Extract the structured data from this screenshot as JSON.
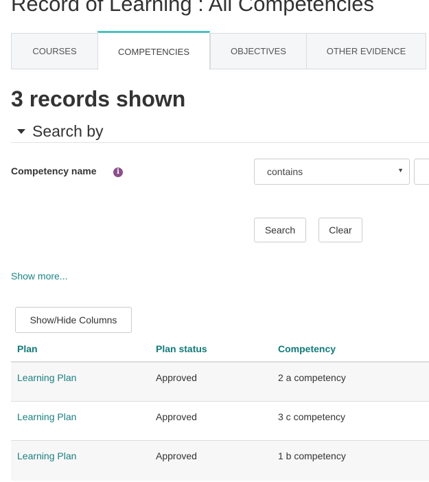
{
  "page_title": "Record of Learning : All Competencies",
  "tabs": [
    {
      "label": "COURSES",
      "active": false
    },
    {
      "label": "COMPETENCIES",
      "active": true
    },
    {
      "label": "OBJECTIVES",
      "active": false
    },
    {
      "label": "OTHER EVIDENCE",
      "active": false
    }
  ],
  "records_count": "3 records shown",
  "search": {
    "heading": "Search by",
    "field_label": "Competency name",
    "operator_value": "contains",
    "search_label": "Search",
    "clear_label": "Clear",
    "show_more": "Show more..."
  },
  "table": {
    "show_hide_label": "Show/Hide Columns",
    "columns": [
      "Plan",
      "Plan status",
      "Competency"
    ],
    "rows": [
      [
        "Learning Plan",
        "Approved",
        "2 a competency"
      ],
      [
        "Learning Plan",
        "Approved",
        "3 c competency"
      ],
      [
        "Learning Plan",
        "Approved",
        "1 b competency"
      ]
    ]
  },
  "colors": {
    "accent": "#4bc3bf",
    "link": "#1a7f80",
    "info_icon": "#8b4f8b"
  }
}
